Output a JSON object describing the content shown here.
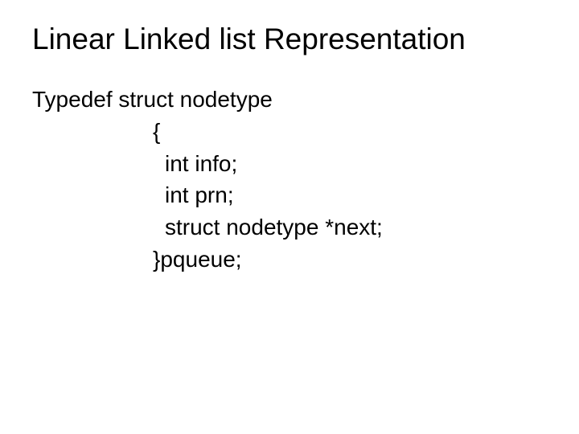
{
  "title": "Linear Linked list Representation",
  "code": {
    "l1": "Typedef struct nodetype",
    "l2": "{",
    "l3": "int info;",
    "l4": "int prn;",
    "l5": "struct nodetype *next;",
    "l6": "}pqueue;"
  }
}
